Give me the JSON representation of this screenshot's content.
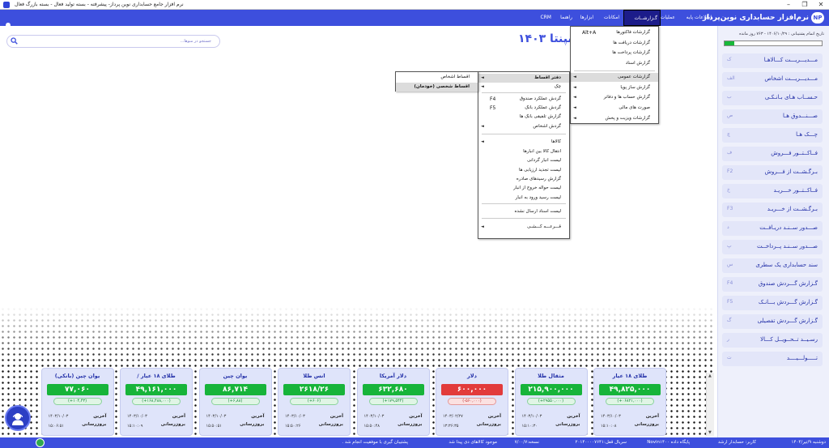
{
  "window": {
    "title": "نرم افزار جامع حسابداری نوین پرداز- پیشرفته - بسته تولید فعال - بسته بازرگ فعال",
    "minimize": "–",
    "maximize": "❐",
    "close": "✕"
  },
  "menubar": {
    "brand": "نرم‌افزار حسابداری نوین‌پرداز",
    "brand_logo": "NP",
    "items": [
      "اطلاعات پایه",
      "عملیات",
      "گـزارشــات",
      "امکانات",
      "ابزارها",
      "راهنما",
      "CRM"
    ],
    "active": "گـزارشــات"
  },
  "search": {
    "placeholder": "جستجو در منوها..."
  },
  "company_title": "شرکـ         سپنتا ۱۴۰۳",
  "sidebar": {
    "license_text": "تاریخ اتمام پشتیبانی : ۱۴۰۶/۱۰/۲۹ - ۷۶۳ روز مانده",
    "license_progress": 0.1,
    "items": [
      {
        "label": "مـــدیـــریـــت کـــالاهـا",
        "key": "ک"
      },
      {
        "label": "مـــدیـــریـــت اشخاص",
        "key": "الف"
      },
      {
        "label": "حـســاب هـای بـانـکـی",
        "key": "ب"
      },
      {
        "label": "صـــنـــدوق هـا",
        "key": "ص"
      },
      {
        "label": "چـــک هـا",
        "key": "چ"
      },
      {
        "label": "فــاکــتــور فـــروش",
        "key": "ف"
      },
      {
        "label": "بـرگـشــت از فـــروش",
        "key": "F2"
      },
      {
        "label": "فــاکــتــور خـــریـد",
        "key": "خ"
      },
      {
        "label": "بـرگـشــت از خـــریـد",
        "key": "F3"
      },
      {
        "label": "صـــدور ســنـد دریـافــت",
        "key": "د"
      },
      {
        "label": "صـــدور ســنـد پــرداخــت",
        "key": "پ"
      },
      {
        "label": "سند حسابداری یک سطری",
        "key": "س"
      },
      {
        "label": "گـزارش گـــردش صندوق",
        "key": "F4"
      },
      {
        "label": "گـزارش گـــردش بـــانـک",
        "key": "F5"
      },
      {
        "label": "گـزارش گـــردش تفصیلی",
        "key": "گ"
      },
      {
        "label": "رسـیــد تــحــویــل کـــالا",
        "key": "ر"
      },
      {
        "label": "تـــــولـــیــــد",
        "key": "ت"
      }
    ]
  },
  "reports_menu": {
    "items": [
      {
        "label": "گزارشات فاکتورها",
        "shortcut": "Alt+A",
        "arrow": false
      },
      {
        "label": "گزارشات دریافت ها",
        "shortcut": "",
        "arrow": false
      },
      {
        "label": "گزارشات پرداخت ها",
        "shortcut": "",
        "arrow": false
      },
      {
        "label": "گزارش اسناد",
        "shortcut": "",
        "arrow": false
      },
      {
        "label": "گزارشات عمومی",
        "shortcut": "",
        "arrow": true
      },
      {
        "label": "گزارش ساز پویا",
        "shortcut": "",
        "arrow": true
      },
      {
        "label": "گزارش حساب ها و دفاتر",
        "shortcut": "",
        "arrow": true
      },
      {
        "label": "صورت های مالی",
        "shortcut": "",
        "arrow": true
      },
      {
        "label": "گزارشات ویزیت و پخش",
        "shortcut": "",
        "arrow": true
      }
    ]
  },
  "general_menu": {
    "items": [
      {
        "label": "دفتر اقساط",
        "shortcut": "",
        "arrow": true,
        "bold": true
      },
      {
        "label": "چک",
        "shortcut": "",
        "arrow": true,
        "bold": false
      },
      {
        "label": "گردش عملکرد صندوق",
        "shortcut": "F4",
        "arrow": false,
        "bold": false
      },
      {
        "label": "گردش عملکرد بانک",
        "shortcut": "F5",
        "arrow": false,
        "bold": false
      },
      {
        "label": "گزارش تلفیقی بانک ها",
        "shortcut": "",
        "arrow": false,
        "bold": false
      },
      {
        "label": "گردش اشخاص",
        "shortcut": "",
        "arrow": true,
        "bold": false
      },
      {
        "label": "کالاها",
        "shortcut": "",
        "arrow": true,
        "bold": false
      },
      {
        "label": "انتقال کالا بین انبارها",
        "shortcut": "",
        "arrow": false,
        "bold": false
      },
      {
        "label": "لیست انبار گردانی",
        "shortcut": "",
        "arrow": false,
        "bold": false
      },
      {
        "label": "لیست تجدید ارزیابی ها",
        "shortcut": "",
        "arrow": false,
        "bold": false
      },
      {
        "label": "گزارش رسیدهای صادره",
        "shortcut": "",
        "arrow": false,
        "bold": false
      },
      {
        "label": "لیست حواله خروج از انبار",
        "shortcut": "",
        "arrow": false,
        "bold": false
      },
      {
        "label": "لیست رسید ورود به انبار",
        "shortcut": "",
        "arrow": false,
        "bold": false
      },
      {
        "label": "لیست اسناد ارسال نشده",
        "shortcut": "",
        "arrow": false,
        "bold": false
      },
      {
        "label": "قـــرعـــه کـــشـی",
        "shortcut": "",
        "arrow": true,
        "bold": false
      }
    ]
  },
  "installments_menu": {
    "items": [
      {
        "label": "اقساط اشخاص",
        "bold": false
      },
      {
        "label": "اقساط شخصی (خودمان)",
        "bold": true
      }
    ]
  },
  "cards": [
    {
      "title": "طلای ۱۸ عیار",
      "value": "۴۹,۸۲۵,۰۰۰",
      "change": "(+۰۶۸۲۱,۰۰۰)",
      "up": true,
      "r1l": "آخرین",
      "r1v": "۱۴۰۳/۱۰/۰۳",
      "r2l": "بروزرسانی",
      "r2v": "۱۵:۱۰:۰۸"
    },
    {
      "title": "مثقال طلا",
      "value": "۲۱۵,۹۰۰,۰۰۰",
      "change": "(+۲۹۵۵۰,۰۰۰)",
      "up": true,
      "r1l": "آخرین",
      "r1v": "۱۴۰۳/۱۰/۰۳",
      "r2l": "بروزرسانی",
      "r2v": "۱۵:۱۰:۳۰"
    },
    {
      "title": "دلار",
      "value": "۶۰۰,۰۰۰",
      "change": "(-۵۶۰,۰۰۰)",
      "up": false,
      "r1l": "آخرین",
      "r1v": "۱۴۰۳/۰۲/۲۷",
      "r2l": "بروزرسانی",
      "r2v": "۱۳:۳۶:۳۵"
    },
    {
      "title": "دلار آمریکا",
      "value": "۶۳۲,۶۸۰",
      "change": "(+۱۷۹,۵۴۴)",
      "up": true,
      "r1l": "آخرین",
      "r1v": "۱۴۰۳/۱۰/۰۳",
      "r2l": "بروزرسانی",
      "r2v": "۱۵:۵۰:۴۸"
    },
    {
      "title": "انس طلا",
      "value": "۲۶۱۸/۲۶",
      "change": "(+۶۰۶)",
      "up": true,
      "r1l": "آخرین",
      "r1v": "۱۴۰۳/۱۰/۰۳",
      "r2l": "بروزرسانی",
      "r2v": "۱۵:۵۰:۲۶"
    },
    {
      "title": "یوان چین",
      "value": "۸۶,۷۱۴",
      "change": "(+۶,۸۸)",
      "up": true,
      "r1l": "آخرین",
      "r1v": "۱۴۰۳/۱۰/۰۳",
      "r2l": "بروزرسانی",
      "r2v": "۱۵:۵۰:۵۱"
    },
    {
      "title": "طلای ۱۸ عیار /",
      "value": "۴۹,۱۶۱,۰۰۰",
      "change": "(+۱۶۸,۴۸۸,۰۰۰)",
      "up": true,
      "r1l": "آخرین",
      "r1v": "۱۴۰۳/۱۰/۰۳",
      "r2l": "بروزرسانی",
      "r2v": "۱۵:۱۰:۰۹"
    },
    {
      "title": "یوان چین (بانکی)",
      "value": "۷۷,۰۶۰",
      "change": "(+۱۰۴,۴۳)",
      "up": true,
      "r1l": "آخرین",
      "r1v": "۱۴۰۳/۱۰/۰۳",
      "r2l": "بروزرسانی",
      "r2v": "۱۵:۰۶:۵۱"
    }
  ],
  "status": {
    "date": "دوشنبه ۹/تیر/۱۴۰۴",
    "user": "کاربر: حسابدار ارشد",
    "database": "پایگاه داده Novin۱۴۰۰",
    "serial": "سریال قفل:۲۰۱۴۰۰۰۰۷۶۴۱",
    "version": "نسخه:۷/۰۰/۷",
    "sync": "موجود کالاهای دی پیدا شد",
    "backup": "پشتیبان گیری با موفقیت انجام شد ."
  },
  "colors": {
    "accent": "#3d4fdd",
    "positive": "#17b43a",
    "negative": "#e23b3b",
    "sidebar_bg": "#eef0fb"
  }
}
